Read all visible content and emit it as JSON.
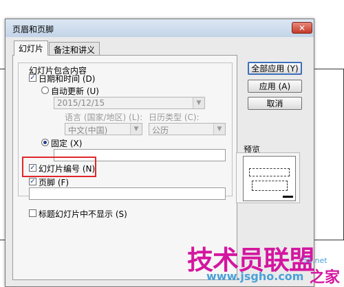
{
  "dialog": {
    "title": "页眉和页脚",
    "close_glyph": "✕"
  },
  "tabs": [
    {
      "label": "幻灯片",
      "active": true
    },
    {
      "label": "备注和讲义",
      "active": false
    }
  ],
  "group": {
    "label": "幻灯片包含内容"
  },
  "datetime": {
    "label": "日期和时间 (D)",
    "checked": true,
    "auto_update_label": "自动更新 (U)",
    "auto_update_selected": false,
    "date_value": "2015/12/15",
    "language_label": "语言 (国家/地区) (L):",
    "language_value": "中文(中国)",
    "calendar_label": "日历类型 (C):",
    "calendar_value": "公历",
    "fixed_label": "固定 (X)",
    "fixed_selected": true,
    "fixed_value": ""
  },
  "slide_number": {
    "label": "幻灯片编号 (N)",
    "checked": true
  },
  "footer": {
    "label": "页脚 (F)",
    "checked": true,
    "value": ""
  },
  "title_slide": {
    "label": "标题幻灯片中不显示 (S)",
    "checked": false
  },
  "buttons": {
    "apply_all": "全部应用 (Y)",
    "apply": "应用 (A)",
    "cancel": "取消"
  },
  "preview": {
    "label": "预览"
  },
  "colors": {
    "highlight": "#e0262a",
    "watermark": "#d4169f",
    "watermark_site": "#4aa0d8"
  },
  "watermark": {
    "brand": "技术员联盟",
    "site": "www.jsgho.com",
    "small": "51.net",
    "tail": "之家"
  }
}
